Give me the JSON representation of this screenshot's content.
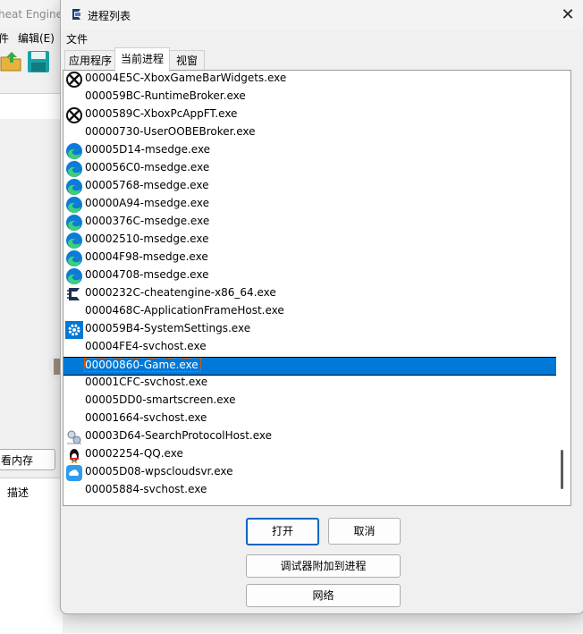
{
  "background_window": {
    "title": "heat Engine",
    "menu": [
      "件",
      "编辑(E)"
    ],
    "memory_button_label": "看内存",
    "desc_label": "描述"
  },
  "dialog": {
    "title": "进程列表",
    "menu_file": "文件",
    "tabs": [
      {
        "label": "应用程序",
        "active": false
      },
      {
        "label": "当前进程",
        "active": true
      },
      {
        "label": "视窗",
        "active": false
      }
    ],
    "processes": [
      {
        "text": "00004E5C-XboxGameBarWidgets.exe",
        "icon": "xbox-icon"
      },
      {
        "text": "000059BC-RuntimeBroker.exe",
        "icon": ""
      },
      {
        "text": "0000589C-XboxPcAppFT.exe",
        "icon": "xbox-icon"
      },
      {
        "text": "00000730-UserOOBEBroker.exe",
        "icon": ""
      },
      {
        "text": "00005D14-msedge.exe",
        "icon": "edge-icon"
      },
      {
        "text": "000056C0-msedge.exe",
        "icon": "edge-icon"
      },
      {
        "text": "00005768-msedge.exe",
        "icon": "edge-icon"
      },
      {
        "text": "00000A94-msedge.exe",
        "icon": "edge-icon"
      },
      {
        "text": "0000376C-msedge.exe",
        "icon": "edge-icon"
      },
      {
        "text": "00002510-msedge.exe",
        "icon": "edge-icon"
      },
      {
        "text": "00004F98-msedge.exe",
        "icon": "edge-icon"
      },
      {
        "text": "00004708-msedge.exe",
        "icon": "edge-icon"
      },
      {
        "text": "0000232C-cheatengine-x86_64.exe",
        "icon": "cheat-engine-icon"
      },
      {
        "text": "0000468C-ApplicationFrameHost.exe",
        "icon": ""
      },
      {
        "text": "000059B4-SystemSettings.exe",
        "icon": "settings-gear-icon"
      },
      {
        "text": "00004FE4-svchost.exe",
        "icon": ""
      },
      {
        "text": "00000860-Game.exe",
        "icon": "",
        "selected": true
      },
      {
        "text": "00001CFC-svchost.exe",
        "icon": ""
      },
      {
        "text": "00005DD0-smartscreen.exe",
        "icon": ""
      },
      {
        "text": "00001664-svchost.exe",
        "icon": ""
      },
      {
        "text": "00003D64-SearchProtocolHost.exe",
        "icon": "search-protocol-icon"
      },
      {
        "text": "00002254-QQ.exe",
        "icon": "qq-penguin-icon"
      },
      {
        "text": "00005D08-wpscloudsvr.exe",
        "icon": "wps-cloud-icon"
      },
      {
        "text": "00005884-svchost.exe",
        "icon": ""
      }
    ],
    "buttons": {
      "open": "打开",
      "cancel": "取消",
      "attach_debugger": "调试器附加到进程",
      "network": "网络"
    }
  },
  "colors": {
    "selection": "#0078d7",
    "primary_border": "#0067c0",
    "edge_blue": "#0c7bd7",
    "edge_green": "#3ccf7a",
    "settings_blue": "#0078d4",
    "cloud_blue": "#2d9cf0"
  }
}
